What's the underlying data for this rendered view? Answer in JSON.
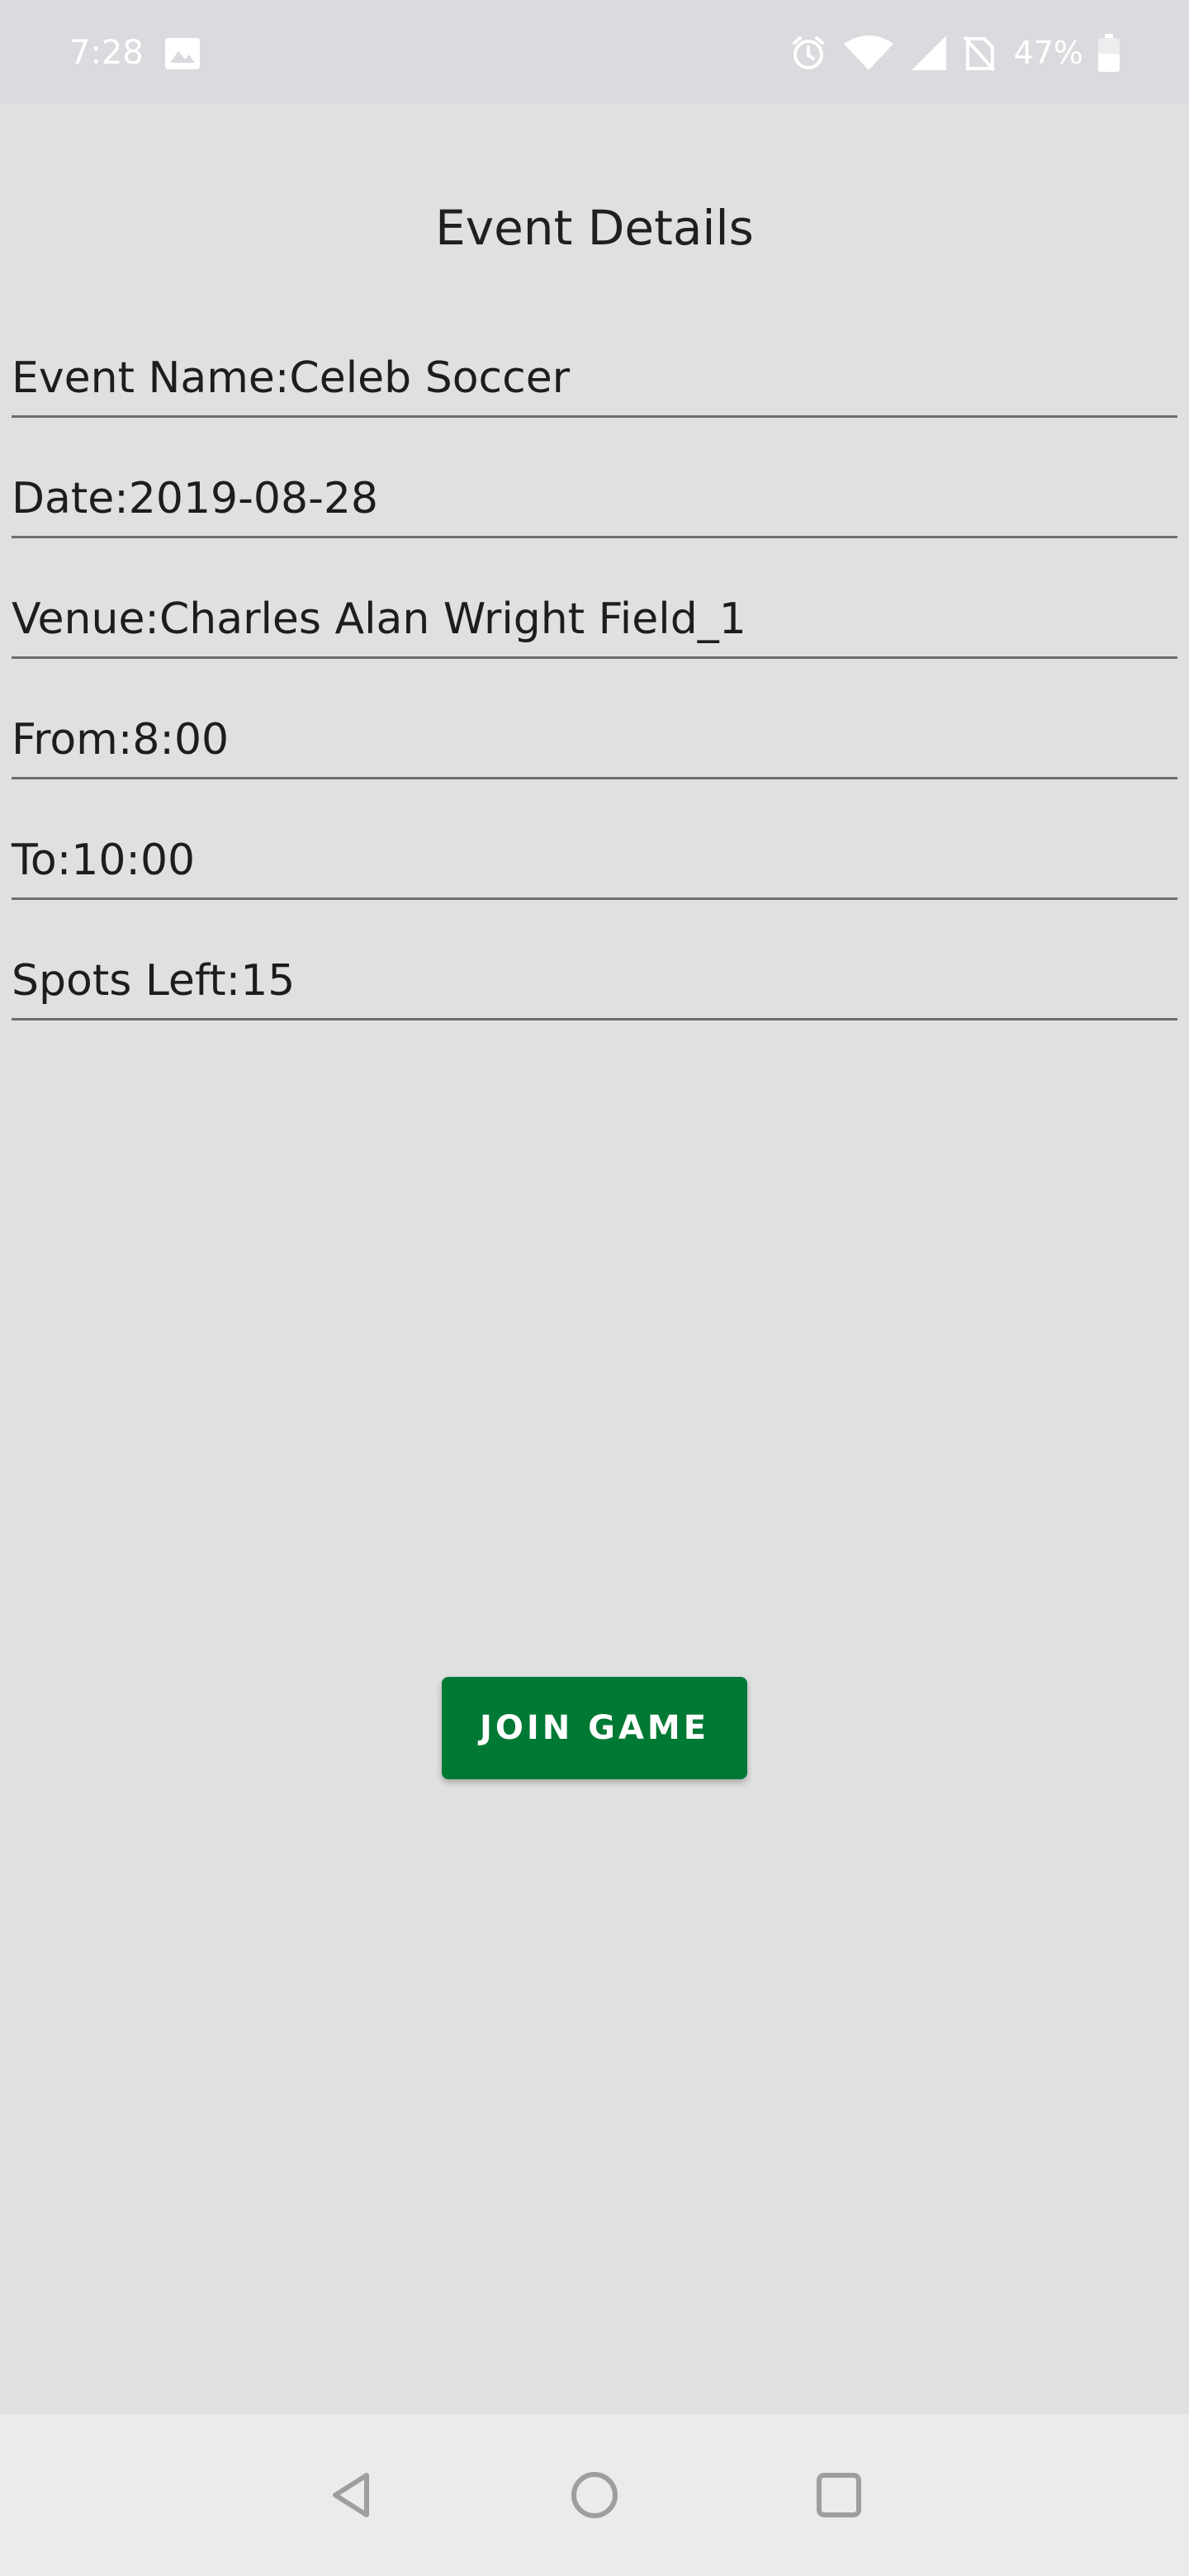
{
  "status_bar": {
    "time": "7:28",
    "battery": "47%",
    "icons": [
      "photo-icon",
      "alarm-icon",
      "wifi-icon",
      "signal-icon",
      "no-sim-icon",
      "battery-icon"
    ]
  },
  "page": {
    "title": "Event Details"
  },
  "fields": [
    {
      "text": "Event Name:Celeb Soccer"
    },
    {
      "text": "Date:2019-08-28"
    },
    {
      "text": "Venue:Charles Alan Wright Field_1"
    },
    {
      "text": "From:8:00"
    },
    {
      "text": "To:10:00"
    },
    {
      "text": "Spots Left:15"
    }
  ],
  "actions": {
    "join_label": "JOIN GAME"
  },
  "colors": {
    "background": "#e0e0e0",
    "accent": "#007934",
    "status_bar": "#dadbde",
    "nav_bar": "#ebebeb"
  },
  "nav": {
    "icons": [
      "back-icon",
      "home-icon",
      "recents-icon"
    ]
  }
}
